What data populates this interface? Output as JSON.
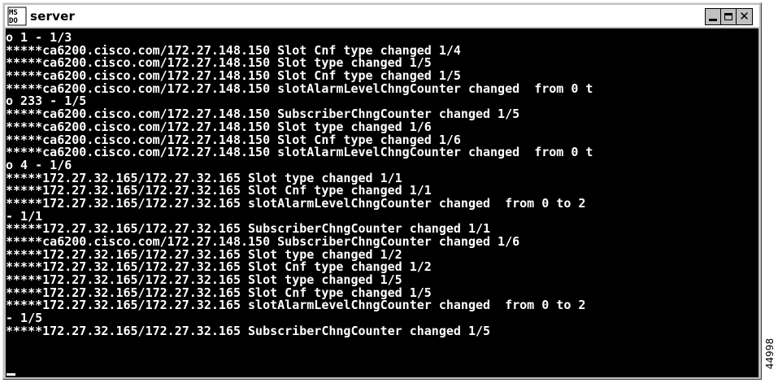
{
  "window": {
    "title": "server",
    "icon": "ms-dos-icon",
    "controls": {
      "minimize": "minimize-icon",
      "maximize": "maximize-icon",
      "close_glyph": "✕"
    }
  },
  "console": {
    "lines": [
      "o 1 - 1/3",
      "*****ca6200.cisco.com/172.27.148.150 Slot Cnf type changed 1/4",
      "*****ca6200.cisco.com/172.27.148.150 Slot type changed 1/5",
      "*****ca6200.cisco.com/172.27.148.150 Slot Cnf type changed 1/5",
      "*****ca6200.cisco.com/172.27.148.150 slotAlarmLevelChngCounter changed  from 0 t",
      "o 233 - 1/5",
      "*****ca6200.cisco.com/172.27.148.150 SubscriberChngCounter changed 1/5",
      "*****ca6200.cisco.com/172.27.148.150 Slot type changed 1/6",
      "*****ca6200.cisco.com/172.27.148.150 Slot Cnf type changed 1/6",
      "*****ca6200.cisco.com/172.27.148.150 slotAlarmLevelChngCounter changed  from 0 t",
      "o 4 - 1/6",
      "*****172.27.32.165/172.27.32.165 Slot type changed 1/1",
      "*****172.27.32.165/172.27.32.165 Slot Cnf type changed 1/1",
      "*****172.27.32.165/172.27.32.165 slotAlarmLevelChngCounter changed  from 0 to 2",
      "- 1/1",
      "*****172.27.32.165/172.27.32.165 SubscriberChngCounter changed 1/1",
      "*****ca6200.cisco.com/172.27.148.150 SubscriberChngCounter changed 1/6",
      "*****172.27.32.165/172.27.32.165 Slot type changed 1/2",
      "*****172.27.32.165/172.27.32.165 Slot Cnf type changed 1/2",
      "*****172.27.32.165/172.27.32.165 Slot type changed 1/5",
      "*****172.27.32.165/172.27.32.165 Slot Cnf type changed 1/5",
      "*****172.27.32.165/172.27.32.165 slotAlarmLevelChngCounter changed  from 0 to 2",
      "- 1/5",
      "*****172.27.32.165/172.27.32.165 SubscriberChngCounter changed 1/5"
    ]
  },
  "figure_id": "44998"
}
